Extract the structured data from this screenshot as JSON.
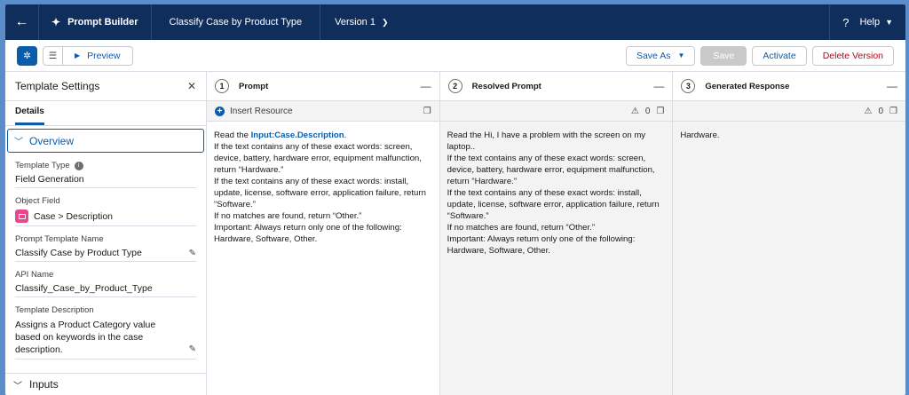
{
  "header": {
    "app_name": "Prompt Builder",
    "template_title": "Classify Case by Product Type",
    "version": "Version 1",
    "help": "Help"
  },
  "toolbar": {
    "preview": "Preview",
    "save_as": "Save As",
    "save": "Save",
    "activate": "Activate",
    "delete_version": "Delete Version"
  },
  "settings": {
    "title": "Template Settings",
    "tab": "Details",
    "section": "Overview",
    "fields": {
      "template_type_label": "Template Type",
      "template_type_value": "Field Generation",
      "object_field_label": "Object Field",
      "object_field_value": "Case > Description",
      "prompt_name_label": "Prompt Template Name",
      "prompt_name_value": "Classify Case by Product Type",
      "api_name_label": "API Name",
      "api_name_value": "Classify_Case_by_Product_Type",
      "description_label": "Template Description",
      "description_value": "Assigns a Product Category value based on keywords in the case description."
    },
    "inputs": "Inputs"
  },
  "prompt": {
    "number": "1",
    "title": "Prompt",
    "insert_resource": "Insert Resource",
    "read_the": "Read the ",
    "merge_field": "Input:Case.Description",
    "after_merge": ".",
    "lines": [
      "If the text contains any of these exact words: screen, device, battery, hardware error, equipment malfunction, return “Hardware.”",
      "If the text contains any of these exact words: install, update, license, software error, application failure, return “Software.”",
      "If no matches are found, return “Other.”",
      "Important: Always return only one of the following: Hardware, Software, Other."
    ]
  },
  "resolved": {
    "number": "2",
    "title": "Resolved Prompt",
    "warnings": "0",
    "lines": [
      "Read the Hi, I have a problem with the screen on my laptop..",
      "If the text contains any of these exact words: screen, device, battery, hardware error, equipment malfunction, return “Hardware.”",
      "If the text contains any of these exact words: install, update, license, software error, application failure, return “Software.”",
      "If no matches are found, return “Other.”",
      "Important: Always return only one of the following: Hardware, Software, Other."
    ]
  },
  "response": {
    "number": "3",
    "title": "Generated Response",
    "warnings": "0",
    "text": "Hardware."
  }
}
